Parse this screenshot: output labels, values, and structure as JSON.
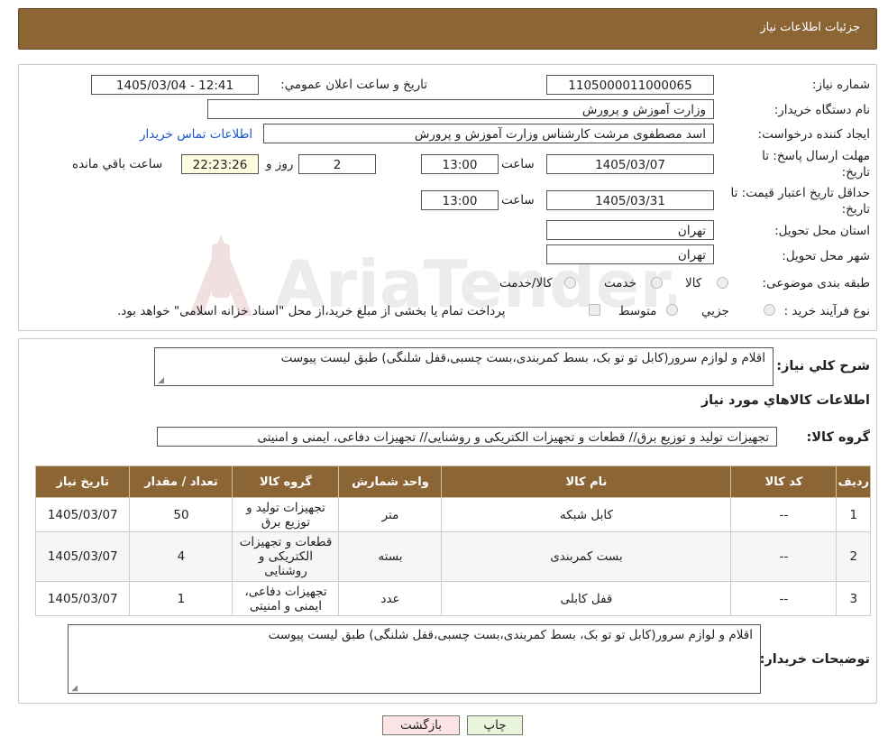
{
  "header": {
    "title": "جزئیات اطلاعات نیاز"
  },
  "watermark": {
    "text": "AriaTender.neT"
  },
  "form": {
    "need_number_label": "شماره نیاز:",
    "need_number": "1105000011000065",
    "announce_label": "تاریخ و ساعت اعلان عمومي:",
    "announce_value": "1405/03/04 - 12:41",
    "buyer_org_label": "نام دستگاه خریدار:",
    "buyer_org": "وزارت آموزش و پرورش",
    "requester_label": "ایجاد کننده درخواست:",
    "requester": "اسد مصطفوی مرشت کارشناس وزارت آموزش و پرورش",
    "contact_link": "اطلاعات تماس خریدار",
    "deadline_label_1": "مهلت ارسال پاسخ: تا",
    "deadline_label_2": "تاریخ:",
    "deadline_date": "1405/03/07",
    "time_label": "ساعت",
    "deadline_time": "13:00",
    "days_value": "2",
    "days_label": "روز و",
    "remaining_time": "22:23:26",
    "remaining_label": "ساعت باقي مانده",
    "validity_label_1": "حداقل تاریخ اعتبار قیمت: تا",
    "validity_label_2": "تاریخ:",
    "validity_date": "1405/03/31",
    "validity_time": "13:00",
    "province_label": "استان محل تحویل:",
    "province": "تهران",
    "city_label": "شهر محل تحویل:",
    "city": "تهران",
    "category_label": "طبقه بندی موضوعی:",
    "category_options": [
      "کالا",
      "خدمت",
      "کالا/خدمت"
    ],
    "process_label": "نوع فرآیند خرید :",
    "process_options": [
      "جزیي",
      "متوسط"
    ],
    "process_note": "پرداخت تمام یا بخشی از مبلغ خرید،از محل \"اسناد خزانه اسلامی\" خواهد بود."
  },
  "summary": {
    "label": "شرح کلي نیاز:",
    "text": "اقلام و لوازم سرور(کابل تو تو بک، بسط کمربندی،بست چسبی،قفل شلنگی) طبق لیست پیوست"
  },
  "goods": {
    "section_title": "اطلاعات کالاهاي مورد نیاز",
    "group_label": "گروه کالا:",
    "group_value": "تجهیزات تولید و توزیع برق// قطعات و تجهیزات الکتریکی و روشنایی// تجهیزات دفاعی، ایمنی و امنیتی"
  },
  "table": {
    "headers": [
      "ردیف",
      "کد کالا",
      "نام کالا",
      "واحد شمارش",
      "گروه کالا",
      "تعداد / مقدار",
      "تاریخ نیاز"
    ],
    "rows": [
      [
        "1",
        "--",
        "کابل شبکه",
        "متر",
        "تجهیزات تولید و توزیع برق",
        "50",
        "1405/03/07"
      ],
      [
        "2",
        "--",
        "بست کمربندی",
        "بسته",
        "قطعات و تجهیزات الکتریکی و روشنایی",
        "4",
        "1405/03/07"
      ],
      [
        "3",
        "--",
        "قفل کابلی",
        "عدد",
        "تجهیزات دفاعی، ایمنی و امنیتی",
        "1",
        "1405/03/07"
      ]
    ]
  },
  "buyer_notes": {
    "label": "توضیحات خریدار:",
    "text": "اقلام و لوازم سرور(کابل تو تو بک، بسط کمربندی،بست چسبی،قفل شلنگی) طبق لیست پیوست"
  },
  "buttons": {
    "print": "چاپ",
    "back": "بازگشت"
  },
  "colors": {
    "header_brown": "#8b6534",
    "link_blue": "#1a56c9",
    "print_green": "#e8f5dc",
    "back_pink": "#fde4e4"
  }
}
